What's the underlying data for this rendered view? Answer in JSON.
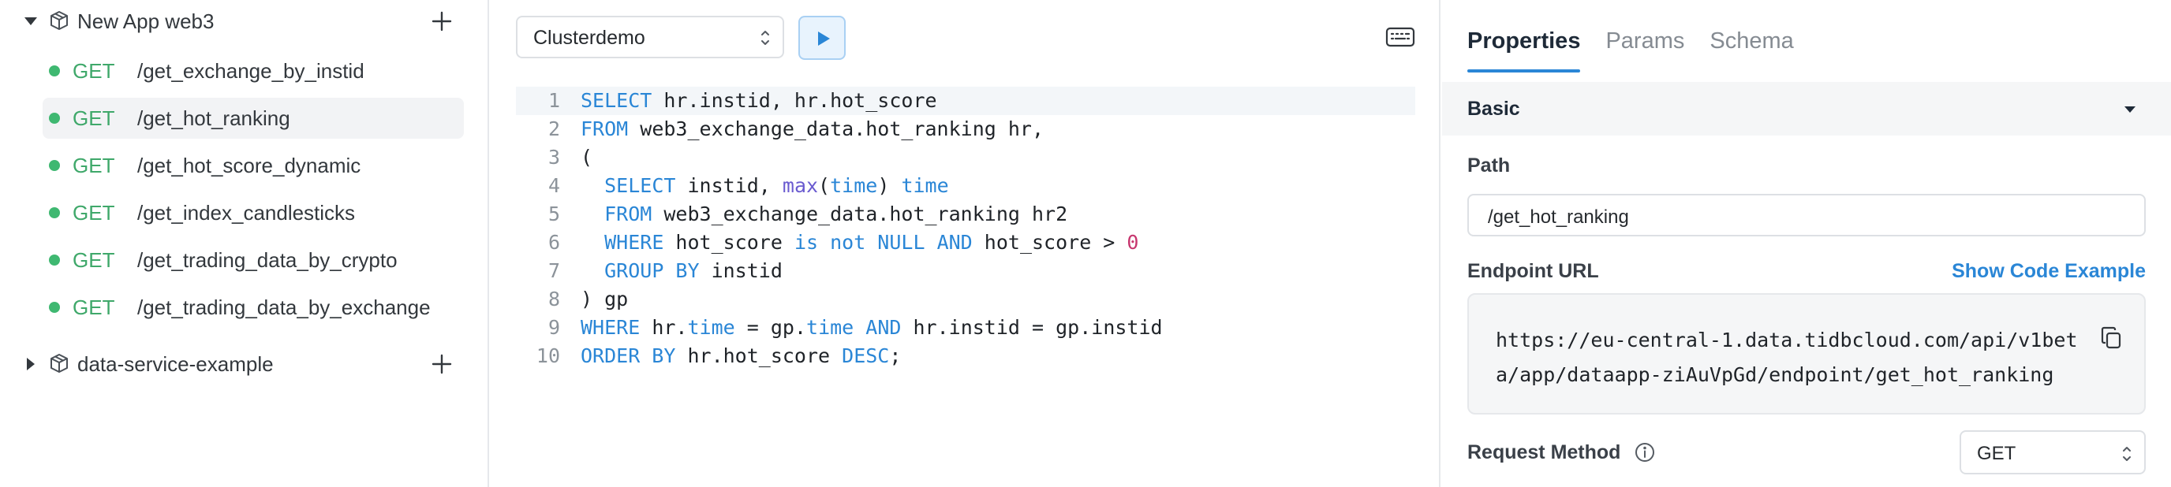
{
  "sidebar": {
    "apps": [
      {
        "name": "New App web3",
        "expanded": true
      },
      {
        "name": "data-service-example",
        "expanded": false
      }
    ],
    "endpoints": [
      {
        "method": "GET",
        "path": "/get_exchange_by_instid"
      },
      {
        "method": "GET",
        "path": "/get_hot_ranking",
        "active": true
      },
      {
        "method": "GET",
        "path": "/get_hot_score_dynamic"
      },
      {
        "method": "GET",
        "path": "/get_index_candlesticks"
      },
      {
        "method": "GET",
        "path": "/get_trading_data_by_crypto"
      },
      {
        "method": "GET",
        "path": "/get_trading_data_by_exchange"
      }
    ]
  },
  "editor": {
    "cluster": "Clusterdemo",
    "line_numbers": [
      "1",
      "2",
      "3",
      "4",
      "5",
      "6",
      "7",
      "8",
      "9",
      "10"
    ],
    "lines": [
      [
        [
          "kw",
          "SELECT"
        ],
        [
          "t",
          " hr.instid, hr.hot_score"
        ]
      ],
      [
        [
          "kw",
          "FROM"
        ],
        [
          "t",
          " web3_exchange_data.hot_ranking hr,"
        ]
      ],
      [
        [
          "t",
          "("
        ]
      ],
      [
        [
          "t",
          "  "
        ],
        [
          "kw",
          "SELECT"
        ],
        [
          "t",
          " instid, "
        ],
        [
          "fn",
          "max"
        ],
        [
          "t",
          "("
        ],
        [
          "kw",
          "time"
        ],
        [
          "t",
          ") "
        ],
        [
          "kw",
          "time"
        ]
      ],
      [
        [
          "t",
          "  "
        ],
        [
          "kw",
          "FROM"
        ],
        [
          "t",
          " web3_exchange_data.hot_ranking hr2"
        ]
      ],
      [
        [
          "t",
          "  "
        ],
        [
          "kw",
          "WHERE"
        ],
        [
          "t",
          " hot_score "
        ],
        [
          "kw",
          "is not NULL AND"
        ],
        [
          "t",
          " hot_score > "
        ],
        [
          "num",
          "0"
        ]
      ],
      [
        [
          "t",
          "  "
        ],
        [
          "kw",
          "GROUP BY"
        ],
        [
          "t",
          " instid"
        ]
      ],
      [
        [
          "t",
          ") gp"
        ]
      ],
      [
        [
          "kw",
          "WHERE"
        ],
        [
          "t",
          " hr."
        ],
        [
          "kw",
          "time"
        ],
        [
          "t",
          " = gp."
        ],
        [
          "kw",
          "time"
        ],
        [
          "t",
          " "
        ],
        [
          "kw",
          "AND"
        ],
        [
          "t",
          " hr.instid = gp.instid"
        ]
      ],
      [
        [
          "kw",
          "ORDER BY"
        ],
        [
          "t",
          " hr.hot_score "
        ],
        [
          "kw",
          "DESC"
        ],
        [
          "t",
          ";"
        ]
      ]
    ]
  },
  "panel": {
    "tabs": [
      "Properties",
      "Params",
      "Schema"
    ],
    "active_tab": "Properties",
    "section": "Basic",
    "path_label": "Path",
    "path_value": "/get_hot_ranking",
    "endpoint_url_label": "Endpoint URL",
    "show_code_label": "Show Code Example",
    "endpoint_url": "https://eu-central-1.data.tidbcloud.com/api/v1beta/app/dataapp-ziAuVpGd/endpoint/get_hot_ranking",
    "request_method_label": "Request Method",
    "request_method": "GET"
  },
  "colors": {
    "accent": "#2a86d6",
    "status_green": "#3fb871",
    "method_green": "#3fa86a"
  }
}
